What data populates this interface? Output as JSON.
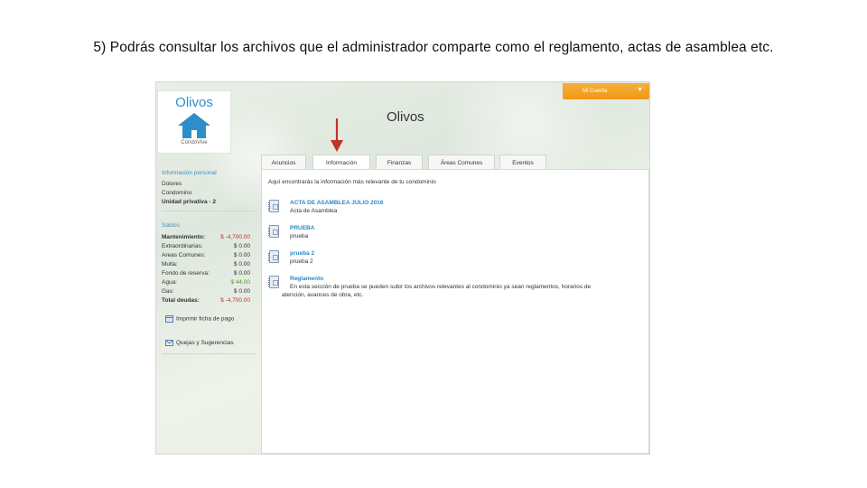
{
  "slide": {
    "caption": "5) Podrás consultar los archivos que el administrador comparte como el reglamento, actas de asamblea etc."
  },
  "app": {
    "logo_title": "Olivos",
    "logo_subtitle": "CondoVive",
    "site_title": "Olivos",
    "account_label": "Mi Cuenta",
    "account_arrow": "▼",
    "brand_color": "#2d8fc8",
    "account_color": "#f2a426"
  },
  "tabs": [
    {
      "label": "Anuncios"
    },
    {
      "label": "Información",
      "active": true
    },
    {
      "label": "Finanzas"
    },
    {
      "label": "Áreas Comunes"
    },
    {
      "label": "Eventos"
    }
  ],
  "sidebar": {
    "personal_header": "Información personal",
    "personal_lines": [
      "Dolores",
      "Condomino",
      "Unidad privativa - 2"
    ],
    "balances_header": "Saldos",
    "balances": [
      {
        "label": "Mantenimiento:",
        "value": "$ -4,700.00"
      },
      {
        "label": "Extraordinarias:",
        "value": "$ 0.00"
      },
      {
        "label": "Areas Comunes:",
        "value": "$ 0.00"
      },
      {
        "label": "Multa:",
        "value": "$ 0.00"
      },
      {
        "label": "Fondo de reserva:",
        "value": "$ 0.00"
      },
      {
        "label": "Agua:",
        "value": "$ 44.00"
      },
      {
        "label": "Gas:",
        "value": "$ 0.00"
      },
      {
        "label": "Total deudas:",
        "value": "$ -4,700.00"
      }
    ],
    "print_link": "Imprimir ficha de pago",
    "complaints_link": "Quejas y Sugerencias"
  },
  "info": {
    "intro": "Aquí encontrarás la información más relevante de tu condominio",
    "files": [
      {
        "name": "ACTA DE ASAMBLEA JULIO 2016",
        "desc": "Acta de Asamblea"
      },
      {
        "name": "PRUEBA",
        "desc": "prueba"
      },
      {
        "name": "prueba 2",
        "desc": "prueba 2"
      },
      {
        "name": "Reglamento",
        "desc": "En esta sección de prueba se pueden subir los archivos relevantes al condominio ya sean reglamentos, horarios de",
        "desc2": "atención, avances de obra, etc."
      }
    ]
  }
}
